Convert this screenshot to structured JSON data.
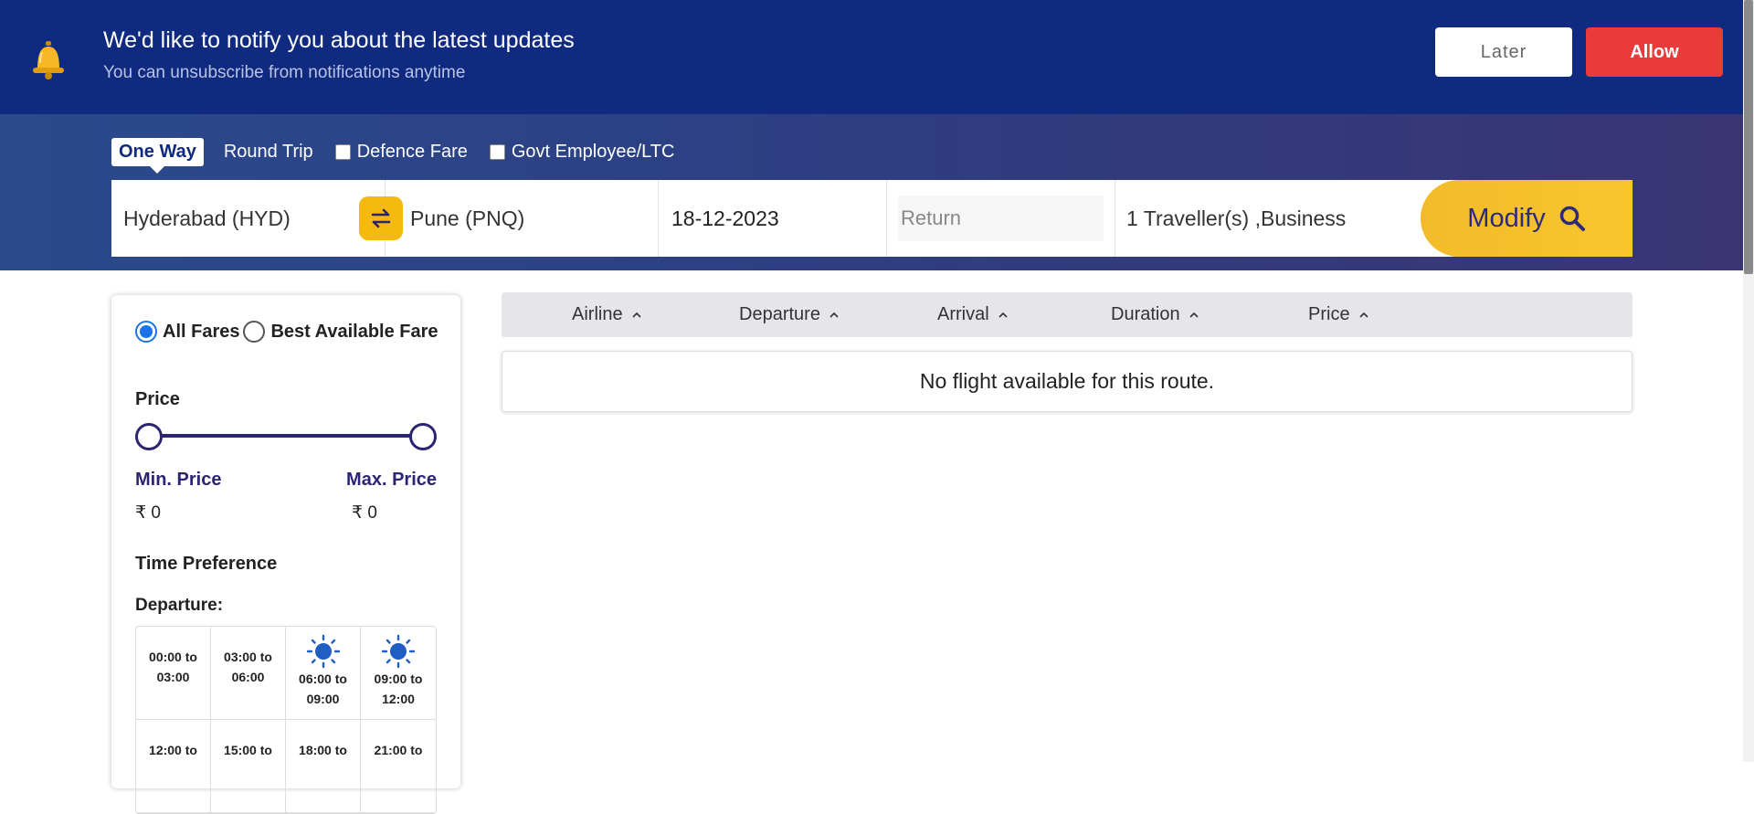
{
  "notification": {
    "title": "We'd like to notify you about the latest updates",
    "subtitle": "You can unsubscribe from notifications anytime",
    "later_label": "Later",
    "allow_label": "Allow",
    "bell_icon": "bell-icon"
  },
  "search": {
    "trip_types": {
      "one_way": "One Way",
      "round_trip": "Round Trip",
      "defence_fare": "Defence Fare",
      "govt_employee": "Govt Employee/LTC"
    },
    "from": "Hyderabad (HYD)",
    "to": "Pune (PNQ)",
    "depart_date": "18-12-2023",
    "return_placeholder": "Return",
    "travellers": "1  Traveller(s) ,Business",
    "modify_label": "Modify",
    "swap_icon": "swap-icon",
    "search_icon": "search-icon"
  },
  "filters": {
    "all_fares": "All Fares",
    "best_fare": "Best Available Fare",
    "price_heading": "Price",
    "min_price_label": "Min. Price",
    "max_price_label": "Max. Price",
    "min_price_value": "₹ 0",
    "max_price_value": "₹ 0",
    "time_heading": "Time Preference",
    "departure_heading": "Departure:",
    "slots": [
      "00:00 to 03:00",
      "03:00 to 06:00",
      "06:00 to 09:00",
      "09:00 to 12:00",
      "12:00 to",
      "15:00 to",
      "18:00 to",
      "21:00 to"
    ]
  },
  "results": {
    "columns": [
      "Airline",
      "Departure",
      "Arrival",
      "Duration",
      "Price"
    ],
    "empty_message": "No flight available for this route."
  },
  "colors": {
    "notify_bg": "#0f2a7e",
    "allow_red": "#ea3a3a",
    "accent_yellow": "#f5b90f",
    "brand_indigo": "#2b2470",
    "radio_blue": "#1a73e8"
  }
}
